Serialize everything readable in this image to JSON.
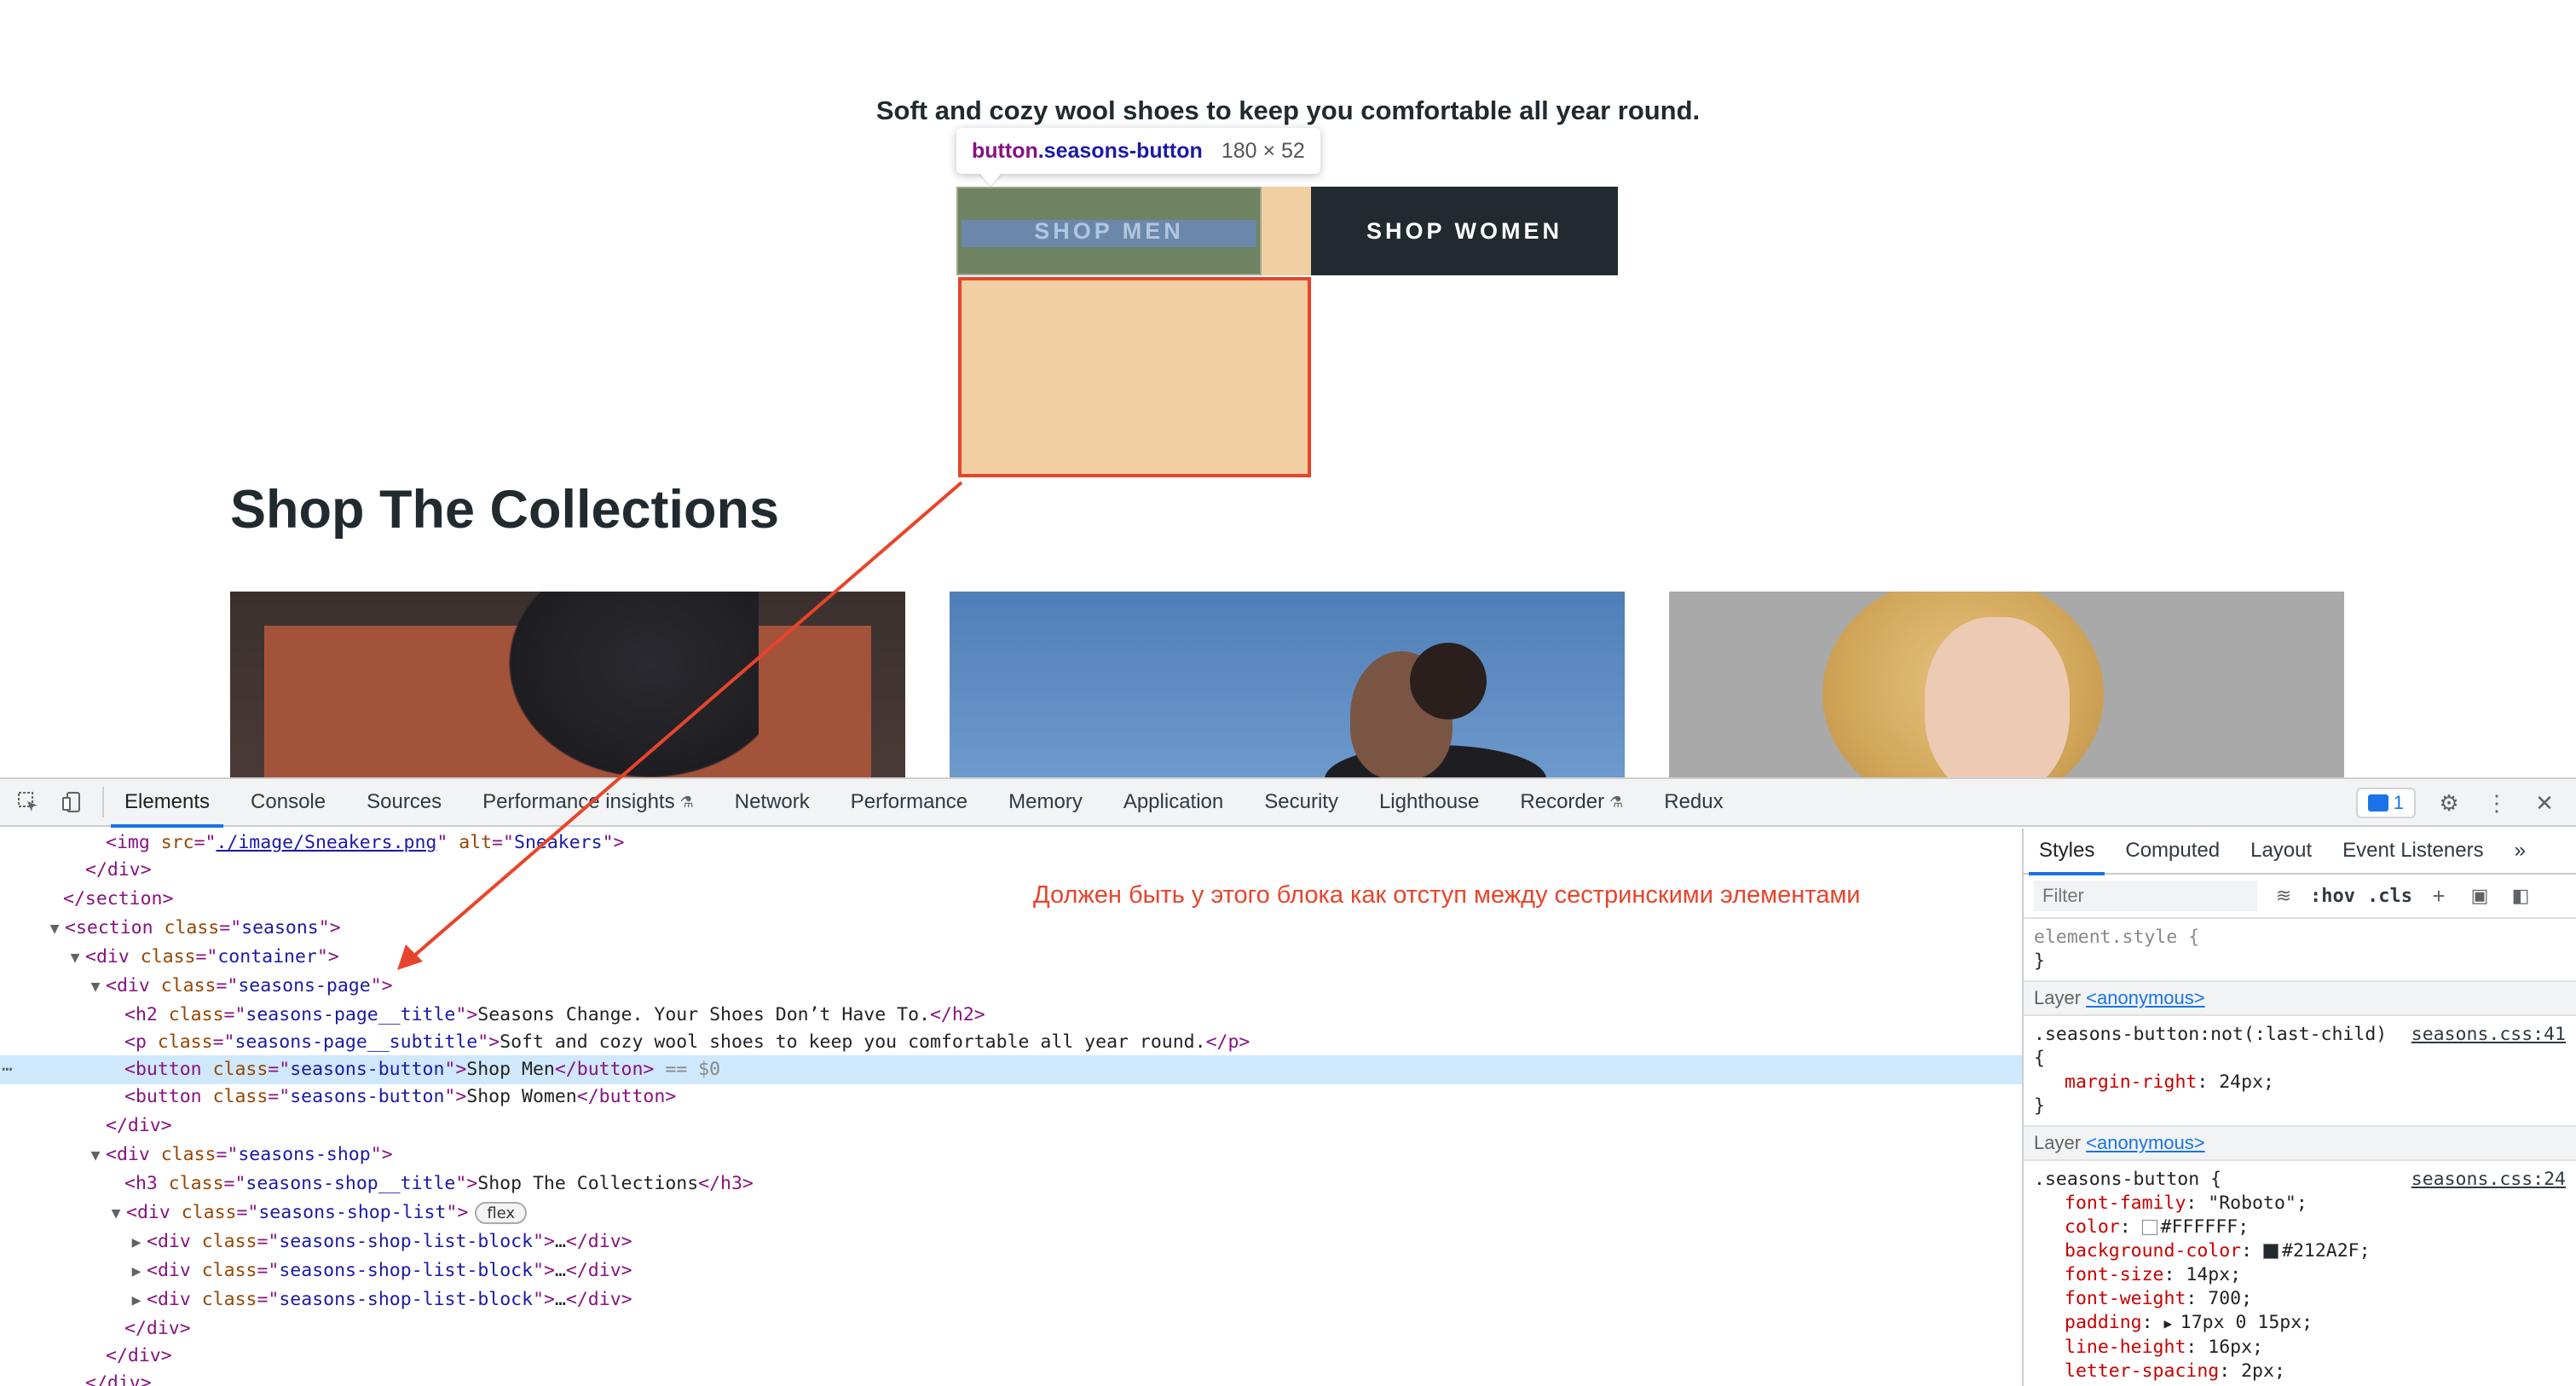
{
  "preview": {
    "subtitle": "Soft and cozy wool shoes to keep you comfortable all year round.",
    "tooltip": {
      "tag": "button",
      "class": ".seasons-button",
      "size": "180 × 52"
    },
    "shop_men_label": "SHOP MEN",
    "shop_women_label": "SHOP WOMEN",
    "collections_title": "Shop The Collections"
  },
  "annotation": "Должен быть у этого блока как отступ между сестринскими элементами",
  "devtools": {
    "tabs": [
      "Elements",
      "Console",
      "Sources",
      "Performance insights",
      "Network",
      "Performance",
      "Memory",
      "Application",
      "Security",
      "Lighthouse",
      "Recorder",
      "Redux"
    ],
    "active_tab": "Elements",
    "messages_count": "1",
    "dom": {
      "l1_tag": "<img",
      "l1_attr1": "src",
      "l1_val1": "./image/Sneakers.png",
      "l1_attr2": "alt",
      "l1_val2": "Sneakers",
      "l1_end": ">",
      "l2": "</div>",
      "l3": "</section>",
      "l4_tag": "<section",
      "l4_attr": "class",
      "l4_val": "seasons",
      "l5_tag": "<div",
      "l5_attr": "class",
      "l5_val": "container",
      "l6_tag": "<div",
      "l6_attr": "class",
      "l6_val": "seasons-page",
      "l7_tag": "<h2",
      "l7_attr": "class",
      "l7_val": "seasons-page__title",
      "l7_text": "Seasons Change. Your Shoes Don’t Have To.",
      "l7_close": "</h2>",
      "l8_tag": "<p",
      "l8_attr": "class",
      "l8_val": "seasons-page__subtitle",
      "l8_text": "Soft and cozy wool shoes to keep you comfortable all year round.",
      "l8_close": "</p>",
      "l9_tag": "<button",
      "l9_attr": "class",
      "l9_val": "seasons-button",
      "l9_text": "Shop Men",
      "l9_close": "</button>",
      "l9_marker": "== $0",
      "l10_tag": "<button",
      "l10_attr": "class",
      "l10_val": "seasons-button",
      "l10_text": "Shop Women",
      "l10_close": "</button>",
      "l11": "</div>",
      "l12_tag": "<div",
      "l12_attr": "class",
      "l12_val": "seasons-shop",
      "l13_tag": "<h3",
      "l13_attr": "class",
      "l13_val": "seasons-shop__title",
      "l13_text": "Shop The Collections",
      "l13_close": "</h3>",
      "l14_tag": "<div",
      "l14_attr": "class",
      "l14_val": "seasons-shop-list",
      "l14_badge": "flex",
      "l15_tag": "<div",
      "l15_attr": "class",
      "l15_val": "seasons-shop-list-block",
      "l15_ellipsis": "…",
      "l15_close": "</div>",
      "l16_tag": "<div",
      "l16_attr": "class",
      "l16_val": "seasons-shop-list-block",
      "l16_ellipsis": "…",
      "l16_close": "</div>",
      "l17_tag": "<div",
      "l17_attr": "class",
      "l17_val": "seasons-shop-list-block",
      "l17_ellipsis": "…",
      "l17_close": "</div>",
      "l18": "</div>",
      "l19": "</div>",
      "l20": "</div>"
    },
    "styles": {
      "tabs": [
        "Styles",
        "Computed",
        "Layout",
        "Event Listeners"
      ],
      "filter_placeholder": "Filter",
      "hov": ":hov",
      "cls": ".cls",
      "element_style": "element.style {",
      "close_brace": "}",
      "layer_label": "Layer",
      "layer_link": "<anonymous>",
      "rule1_selector": ".seasons-button:not(:last-child) {",
      "rule1_source": "seasons.css:41",
      "rule1_prop": "margin-right",
      "rule1_value": "24px;",
      "rule2_selector": ".seasons-button {",
      "rule2_source": "seasons.css:24",
      "rule2_props": [
        {
          "name": "font-family",
          "value": "\"Roboto\";"
        },
        {
          "name": "color",
          "value": "#FFFFFF;",
          "swatch": "#FFFFFF"
        },
        {
          "name": "background-color",
          "value": "#212A2F;",
          "swatch": "#212A2F"
        },
        {
          "name": "font-size",
          "value": "14px;"
        },
        {
          "name": "font-weight",
          "value": "700;"
        },
        {
          "name": "padding",
          "value": "17px 0 15px;"
        },
        {
          "name": "line-height",
          "value": "16px;"
        },
        {
          "name": "letter-spacing",
          "value": "2px;"
        }
      ]
    }
  },
  "colors": {
    "accent": "#1A73E8",
    "annotation": "#E8442B",
    "button_dark": "#212A2F",
    "margin_highlight": "#F2CFA2"
  }
}
